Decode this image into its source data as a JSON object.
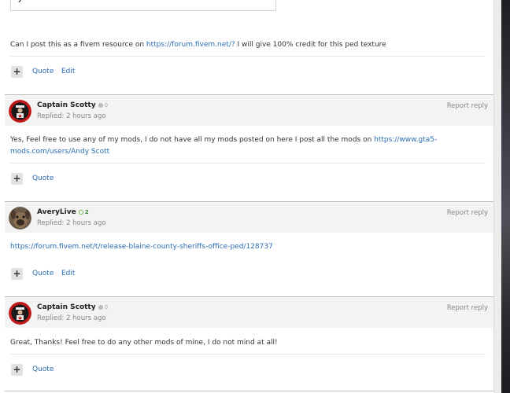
{
  "colors": {
    "link": "#2a6db5",
    "header_bg": "#f3f3f3",
    "muted": "#888888",
    "rep_green": "#6ab04c",
    "rep_grey": "#bbbbbb"
  },
  "intro": {
    "text": "Can I post this as a fivem resource on ",
    "link": "https://forum.fivem.net/?",
    "text_after": " I will give 100% credit for this ped texture",
    "actions": {
      "plus_icon": "+",
      "quote": "Quote",
      "edit": "Edit"
    }
  },
  "posts": [
    {
      "user": "Captain Scotty",
      "rep": "0",
      "avatar_icon": "red-star-avatar-icon",
      "replied": "Replied: 2 hours ago",
      "report": "Report reply",
      "body_text": "Yes, Feel free to use any of my mods, I do not have all my mods posted on here I post all the mods on ",
      "body_link": "https://www.gta5-mods.com/users/Andy Scott",
      "actions": {
        "plus_icon": "+",
        "quote": "Quote"
      }
    },
    {
      "user": "AveryLive",
      "rep": "2",
      "avatar_icon": "dog-avatar-icon",
      "replied": "Replied: 2 hours ago",
      "report": "Report reply",
      "body_link": "https://forum.fivem.net/t/release-blaine-county-sheriffs-office-ped/128737",
      "actions": {
        "plus_icon": "+",
        "quote": "Quote",
        "edit": "Edit"
      }
    },
    {
      "user": "Captain Scotty",
      "rep": "0",
      "avatar_icon": "red-star-avatar-icon",
      "replied": "Replied: 2 hours ago",
      "report": "Report reply",
      "body_text": "Great, Thanks! Feel free to do any other mods of mine, I do not mind at all!",
      "actions": {
        "plus_icon": "+",
        "quote": "Quote"
      }
    }
  ]
}
